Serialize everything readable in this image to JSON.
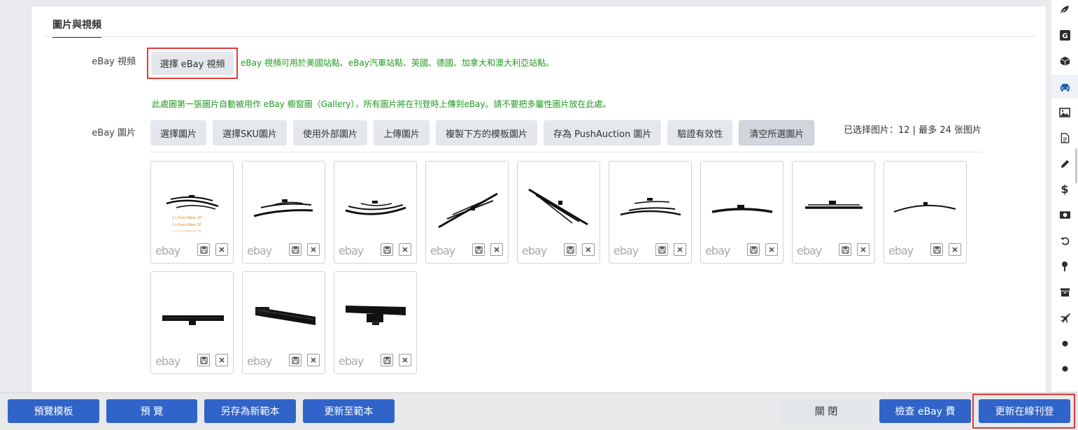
{
  "section": {
    "title": "圖片與視頻"
  },
  "video": {
    "label": "eBay 視頻",
    "button": "選擇 eBay 視頻",
    "note": "eBay 視頻可用於美國站點、eBay汽車站點、英國、德國、加拿大和澳大利亞站點。"
  },
  "images": {
    "note": "此處圖第一張圖片自動被用作 eBay 櫥窗圖（Gallery），所有圖片將在刊登時上傳到eBay。請不要把多屬性圖片放在此處。",
    "label": "eBay 圖片",
    "buttons": {
      "select": "選擇圖片",
      "select_sku": "選擇SKU圖片",
      "external": "使用外部圖片",
      "upload": "上傳圖片",
      "copy_template": "複製下方的模板圖片",
      "save_pushauction": "存為 PushAuction 圖片",
      "validate": "驗證有效性",
      "clear": "清空所選圖片"
    },
    "selected_count": "已选择图片：12 | 最多 24 张图片",
    "thumb_caption": "ebay",
    "thumbs": [
      {
        "name": "wiper-set-with-labels",
        "labels": [
          "1 x Front Wiper 16\"",
          "1 x Front Wiper 26\"",
          "1 x Rear Wiper 13\""
        ]
      },
      {
        "name": "wiper-set-2"
      },
      {
        "name": "wiper-set-3"
      },
      {
        "name": "wiper-set-diagonal"
      },
      {
        "name": "wiper-set-diagonal-2"
      },
      {
        "name": "wiper-set-4"
      },
      {
        "name": "wiper-single-flat"
      },
      {
        "name": "wiper-single-frame"
      },
      {
        "name": "wiper-single-curved"
      },
      {
        "name": "wiper-closeup-1"
      },
      {
        "name": "wiper-closeup-2"
      },
      {
        "name": "wiper-closeup-3"
      }
    ]
  },
  "sidebar": {
    "icons": [
      "leaf-icon",
      "google-icon",
      "box-icon",
      "car-icon",
      "image-icon",
      "file-icon",
      "pencil-icon",
      "dollar-icon",
      "money-icon",
      "undo-icon",
      "map-pin-icon",
      "archive-icon",
      "plane-icon",
      "dot-icon",
      "dot-icon"
    ],
    "active_index": 3,
    "dollar_glyph": "$"
  },
  "footer": {
    "preview_template": "預覽模板",
    "preview": "預 覽",
    "save_as_new": "另存為新範本",
    "update_template": "更新至範本",
    "close": "關 閉",
    "check_fees": "檢查 eBay 費",
    "update_listing": "更新在線刊登"
  },
  "colors": {
    "primary": "#3164c9",
    "note_green": "#1e9a1e",
    "highlight_red": "#e53935"
  }
}
